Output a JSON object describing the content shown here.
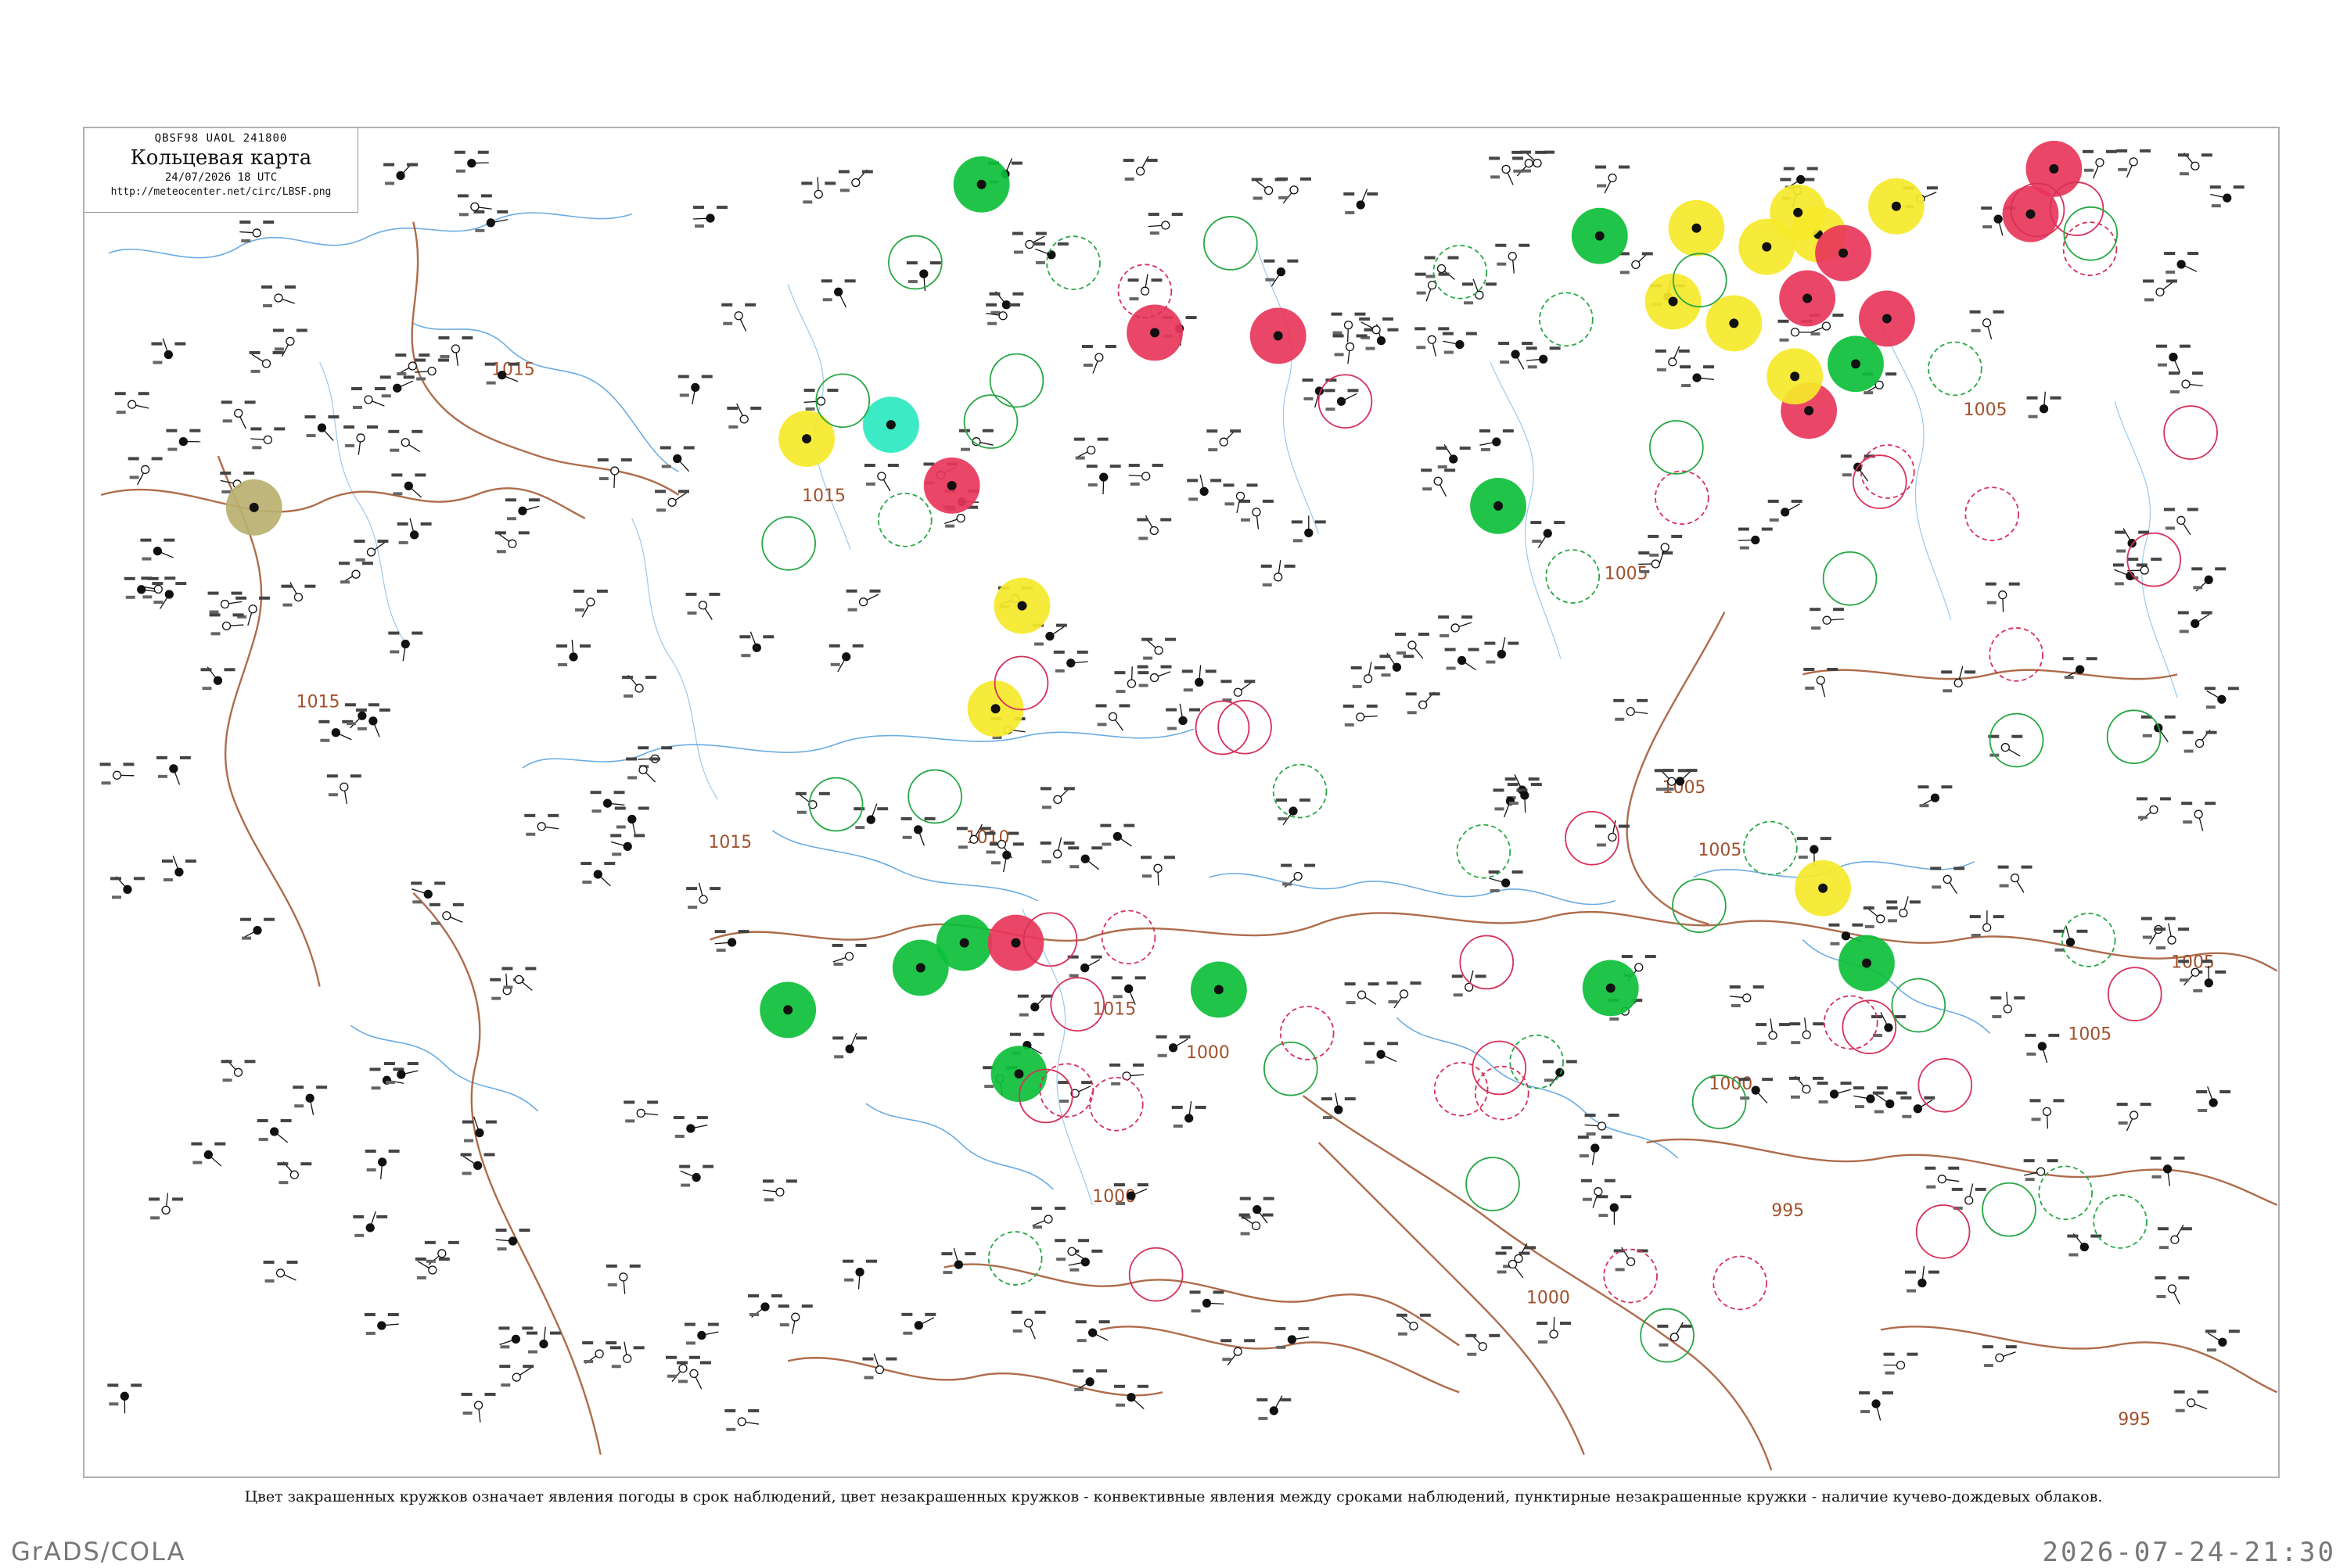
{
  "header": {
    "code": "QBSF98  UAOL  241800",
    "title": "Кольцевая карта",
    "time": "24/07/2026 18 UTC",
    "url": "http://meteocenter.net/circ/LBSF.png"
  },
  "caption": "Цвет закрашенных кружков означает явления погоды в срок наблюдений, цвет незакрашенных кружков - конвективные явления между сроками наблюдений, пунктирные незакрашенные кружки - наличие кучево-дождевых облаков.",
  "footer": {
    "left": "GrADS/COLA",
    "right": "2026-07-24-21:30"
  },
  "isobar_labels": [
    "1015",
    "1015",
    "1015",
    "1015",
    "1010",
    "1005",
    "1005",
    "1005",
    "1005",
    "1005",
    "1005",
    "1000",
    "1000",
    "1000",
    "1000",
    "995",
    "995",
    "1015"
  ],
  "colors": {
    "isobar": "#a0522d",
    "coast": "#3a90d8",
    "thunder_fill": "#e8365a",
    "rain_fill": "#0cbf3a",
    "shower_fill": "#f5e92a",
    "fog_fill": "#b8b070",
    "haze_fill": "#2be8c0",
    "green_ring": "#27a745",
    "red_ring": "#d6305a"
  }
}
